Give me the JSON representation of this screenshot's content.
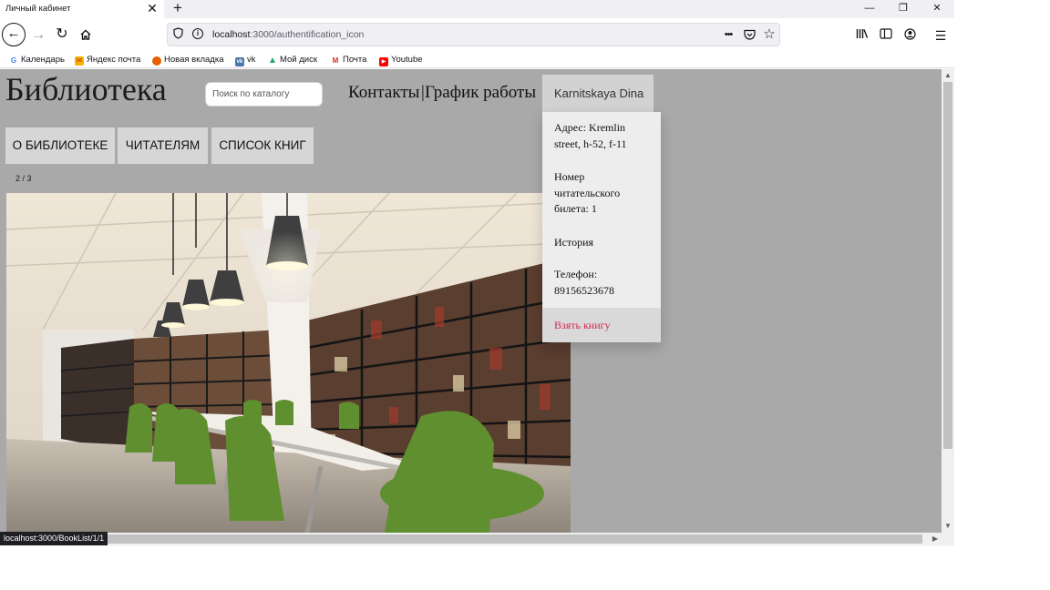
{
  "browser": {
    "tab_title": "Личный кабинет",
    "tab_close": "✕",
    "new_tab": "+",
    "window_controls": [
      "—",
      "❐",
      "✕"
    ],
    "url_host": "localhost",
    "url_rest": ":3000/authentification_icon",
    "page_actions": [
      "•••",
      "pocket-icon",
      "star-icon"
    ],
    "toolbar_icons": [
      "library-icon",
      "sidebar-icon",
      "account-icon",
      "menu-icon"
    ]
  },
  "bookmarks": [
    {
      "label": "Календарь",
      "icon": "G",
      "color": "#4285f4"
    },
    {
      "label": "Яндекс почта",
      "icon": "✉",
      "color": "#f5b400"
    },
    {
      "label": "Новая вкладка",
      "icon": "●",
      "color": "#e66000"
    },
    {
      "label": "vk",
      "icon": "vk",
      "color": "#4a76a8"
    },
    {
      "label": "Мой диск",
      "icon": "▲",
      "color": "#1fa463"
    },
    {
      "label": "Почта",
      "icon": "M",
      "color": "#d93025"
    },
    {
      "label": "Youtube",
      "icon": "▶",
      "color": "#ff0000"
    }
  ],
  "site": {
    "title": "Библиотека",
    "search_placeholder": "Поиск по каталогу",
    "contacts": "Контакты",
    "separator": "|",
    "hours": "График работы",
    "user_name": "Karnitskaya Dina",
    "menu": [
      "О библиотеке",
      "Читателям",
      "Список книг"
    ],
    "slide_counter": "2 / 3"
  },
  "user_menu": {
    "address": "Адрес: Kremlin street, h-52, f-11",
    "ticket": "Номер читательского билета: 1",
    "history": "История",
    "phone": "Телефон: 89156523678",
    "take_book": "Взять книгу"
  },
  "status_bar": "localhost:3000/BookList/1/1"
}
